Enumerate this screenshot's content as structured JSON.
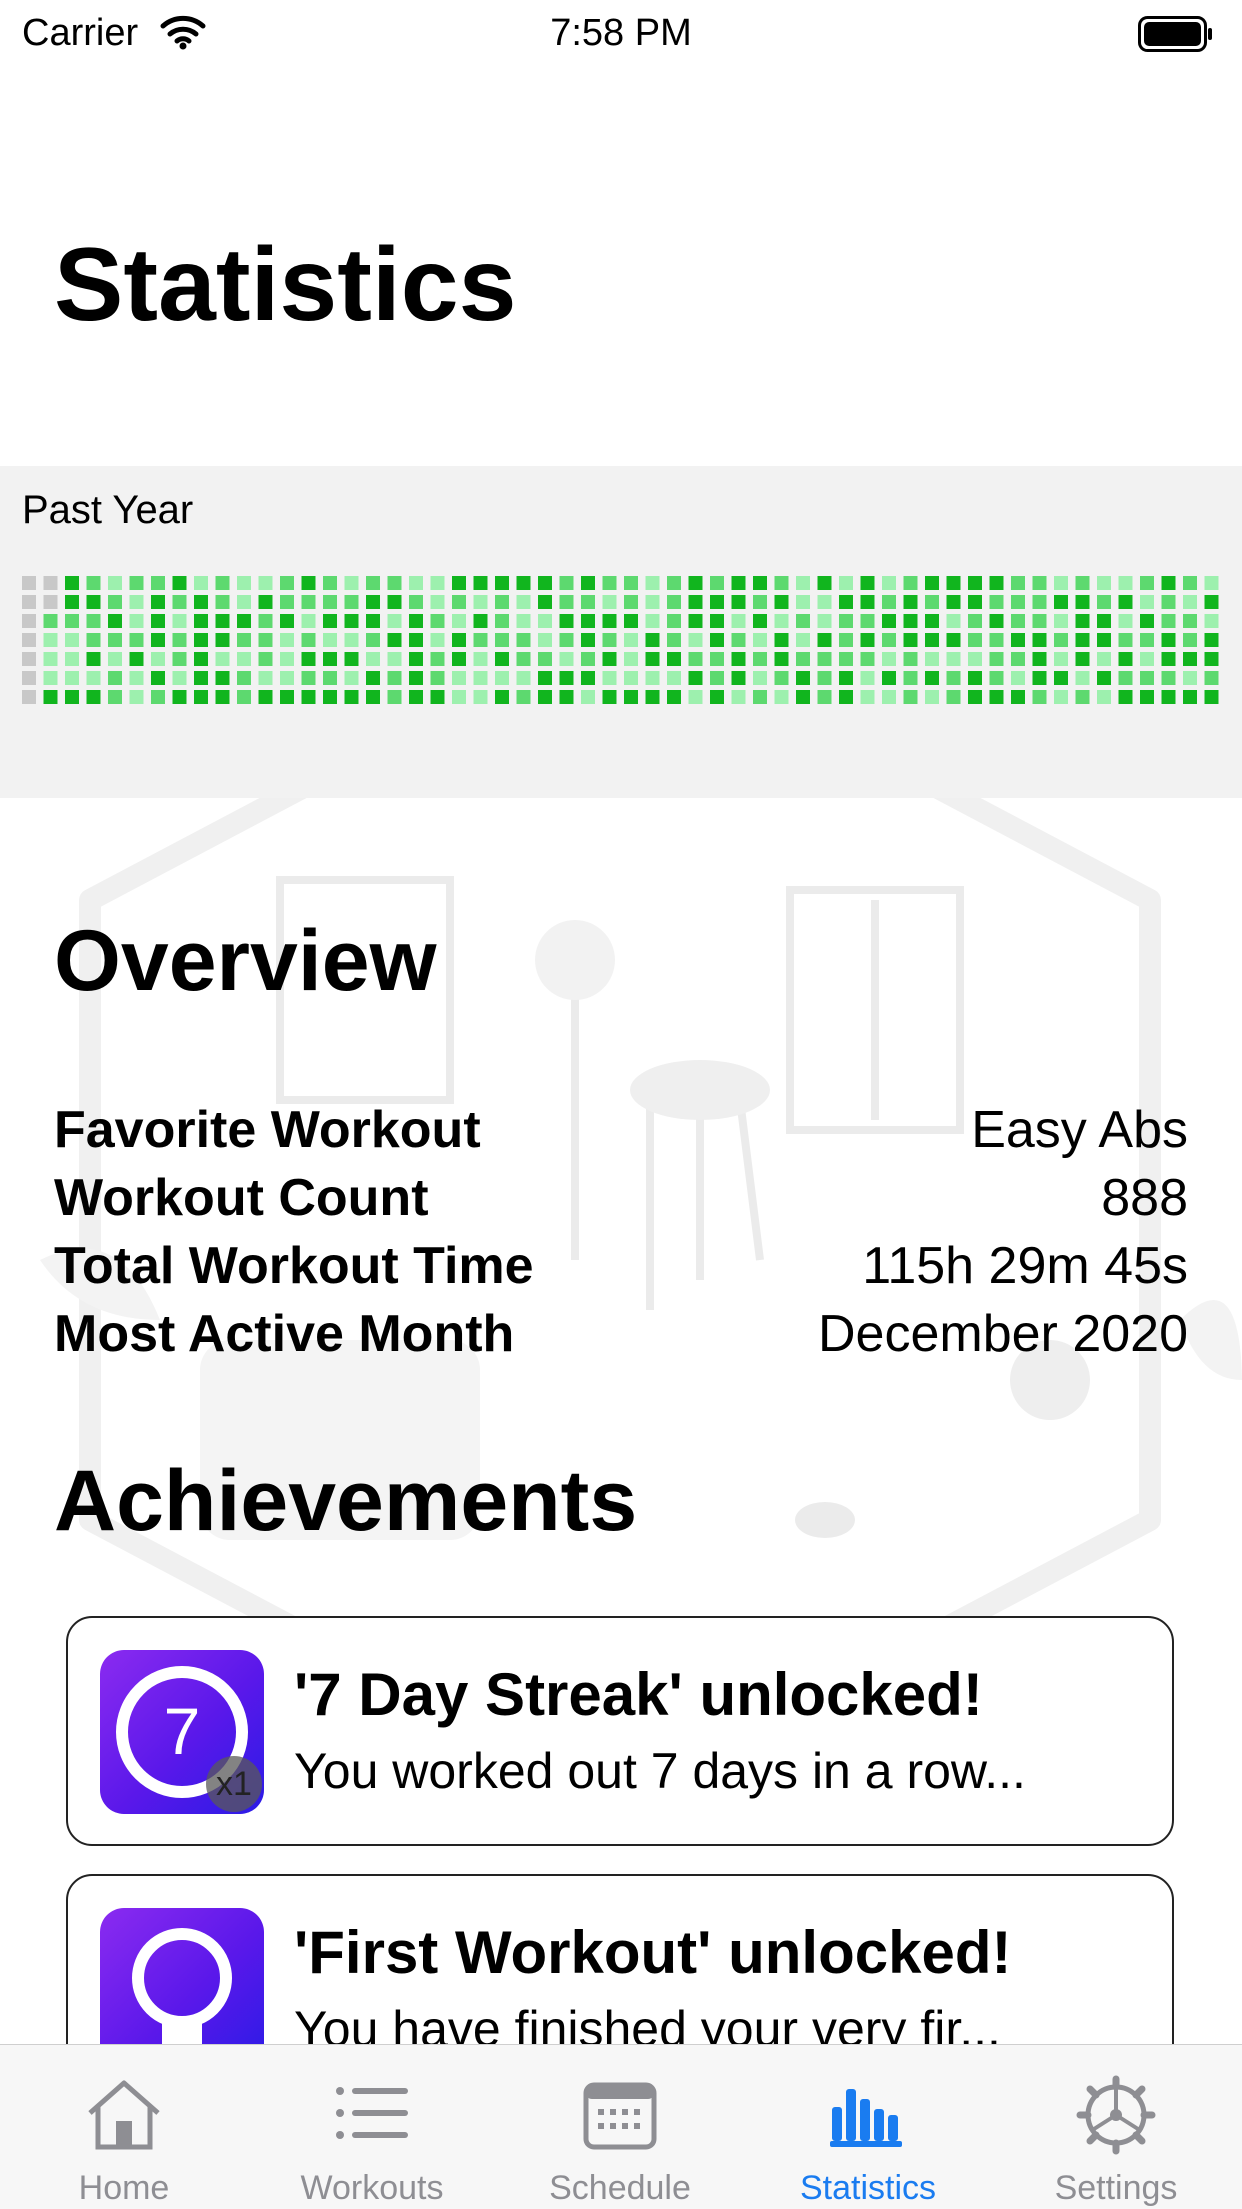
{
  "status_bar": {
    "carrier": "Carrier",
    "time": "7:58 PM"
  },
  "page_title": "Statistics",
  "past_year": {
    "label": "Past Year",
    "colors": {
      "empty": "#c8c8c8",
      "light": "#9df0ae",
      "medium": "#5dd96f",
      "dark": "#11b51e"
    },
    "levels": [
      "0032122312112321221133333232212323321313123333221211232133223223",
      "0033213232132222332121213221212333231133232332223323121323222333",
      "0222313133323133313213211333312331312122333123221331322132223112",
      "0112223233221211233132221232132132131323233322332332232331121331",
      "0113131231121333113231322123133223232222121112231313133333213112",
      "0111213133211221323211113331111323123231323232133132221233232332",
      "0333212333233333323311323313333131213231121233321213333311231133"
    ]
  },
  "overview": {
    "title": "Overview",
    "rows": [
      {
        "label": "Favorite Workout",
        "value": "Easy Abs"
      },
      {
        "label": "Workout Count",
        "value": "888"
      },
      {
        "label": "Total Workout Time",
        "value": "115h 29m 45s"
      },
      {
        "label": "Most Active Month",
        "value": "December 2020"
      }
    ]
  },
  "achievements": {
    "title": "Achievements",
    "items": [
      {
        "title": "'7 Day Streak' unlocked!",
        "description": "You worked out 7 days in a row...",
        "icon": "seven-day-streak-icon",
        "badge_number": "7",
        "count_badge": "x1"
      },
      {
        "title": "'First Workout' unlocked!",
        "description": "You have finished your very fir...",
        "icon": "award-ribbon-icon"
      }
    ]
  },
  "tabs": [
    {
      "label": "Home",
      "icon": "house-icon",
      "active": false
    },
    {
      "label": "Workouts",
      "icon": "list-icon",
      "active": false
    },
    {
      "label": "Schedule",
      "icon": "calendar-icon",
      "active": false
    },
    {
      "label": "Statistics",
      "icon": "bar-chart-icon",
      "active": true
    },
    {
      "label": "Settings",
      "icon": "gear-icon",
      "active": false
    }
  ],
  "colors": {
    "accent": "#1a7cf0",
    "tab_inactive": "#8e8e93",
    "achievement_icon": "#6a1ff0"
  }
}
